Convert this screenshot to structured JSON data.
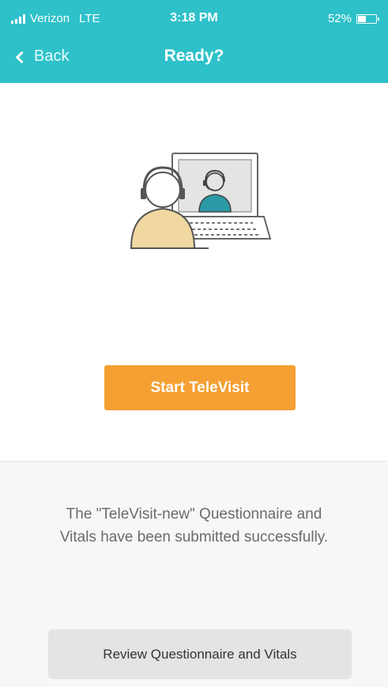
{
  "status_bar": {
    "carrier": "Verizon",
    "network": "LTE",
    "time": "3:18 PM",
    "battery_text": "52%",
    "battery_level": 0.52
  },
  "nav": {
    "back_label": "Back",
    "title": "Ready?"
  },
  "illustration": {
    "icon": "televisit-illustration-icon"
  },
  "actions": {
    "start_label": "Start TeleVisit",
    "review_label": "Review Questionnaire and Vitals"
  },
  "message": {
    "text": "The \"TeleVisit-new\" Questionnaire and Vitals have been submitted successfully."
  },
  "colors": {
    "header": "#2ec1c9",
    "start_button": "#f5a033",
    "doctor": "#2a9aa6",
    "patient": "#f0d8a0"
  }
}
